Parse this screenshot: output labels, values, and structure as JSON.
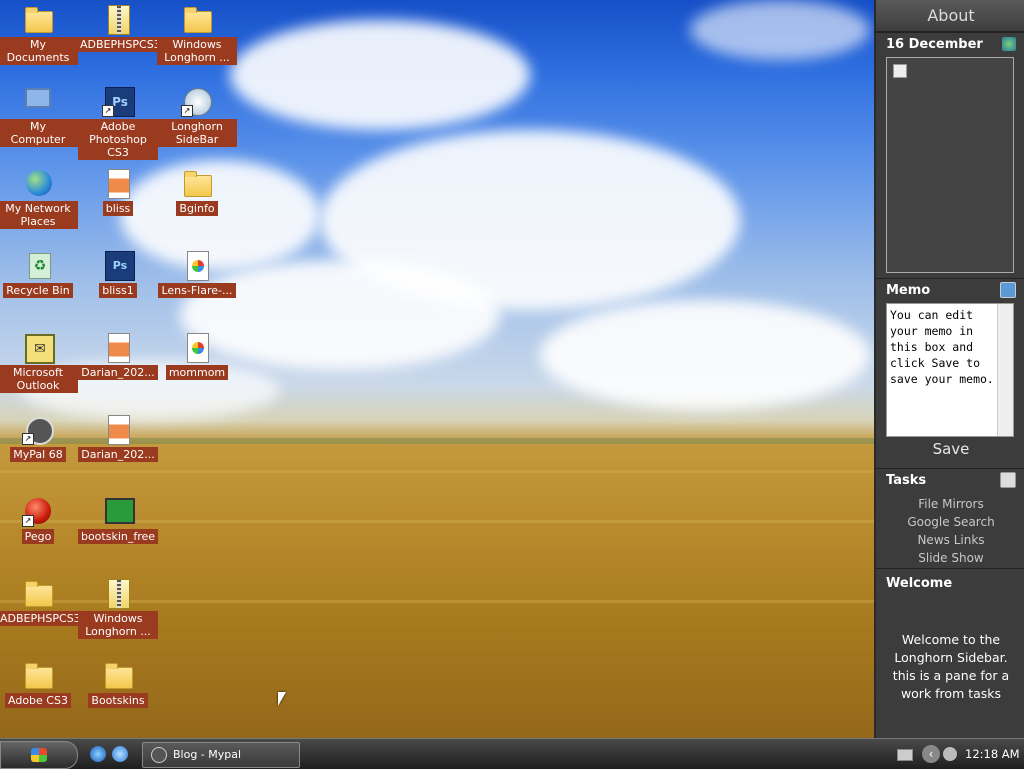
{
  "desktop": {
    "icons": [
      {
        "label": "My Documents"
      },
      {
        "label": "ADBEPHSPCS3"
      },
      {
        "label": "Windows Longhorn ..."
      },
      {
        "label": "My Computer"
      },
      {
        "label": "Adobe Photoshop CS3"
      },
      {
        "label": "Longhorn SideBar"
      },
      {
        "label": "My Network Places"
      },
      {
        "label": "bliss"
      },
      {
        "label": "Bginfo"
      },
      {
        "label": "Recycle Bin"
      },
      {
        "label": "bliss1"
      },
      {
        "label": "Lens-Flare-..."
      },
      {
        "label": "Microsoft Outlook"
      },
      {
        "label": "Darian_202..."
      },
      {
        "label": "mommom"
      },
      {
        "label": "MyPal 68"
      },
      {
        "label": "Darian_202..."
      },
      {
        "label": "Pego"
      },
      {
        "label": "bootskin_free"
      },
      {
        "label": "ADBEPHSPCS3"
      },
      {
        "label": "Windows Longhorn ..."
      },
      {
        "label": "Adobe CS3"
      },
      {
        "label": "Bootskins"
      }
    ]
  },
  "sidebar": {
    "about": "About",
    "calendar": {
      "date": "16 December"
    },
    "memo": {
      "title": "Memo",
      "text": "You can edit your memo in this box and click Save to save your memo.",
      "save_label": "Save"
    },
    "tasks": {
      "title": "Tasks",
      "items": [
        {
          "label": "File Mirrors"
        },
        {
          "label": "Google Search"
        },
        {
          "label": "News Links"
        },
        {
          "label": "Slide Show"
        }
      ]
    },
    "welcome": {
      "title": "Welcome",
      "text": "Welcome to the Longhorn Sidebar. this is a pane for a work from tasks"
    }
  },
  "taskbar": {
    "window_button": "Blog - Mypal",
    "clock": "12:18 AM"
  },
  "icons_semantic": [
    "folder-icon",
    "zip-folder-icon",
    "photoshop-icon",
    "computer-icon",
    "network-globe-icon",
    "recycle-bin-icon",
    "outlook-icon",
    "disc-icon",
    "raccoon-icon",
    "record-button-icon",
    "monitor-icon",
    "image-document-icon"
  ]
}
